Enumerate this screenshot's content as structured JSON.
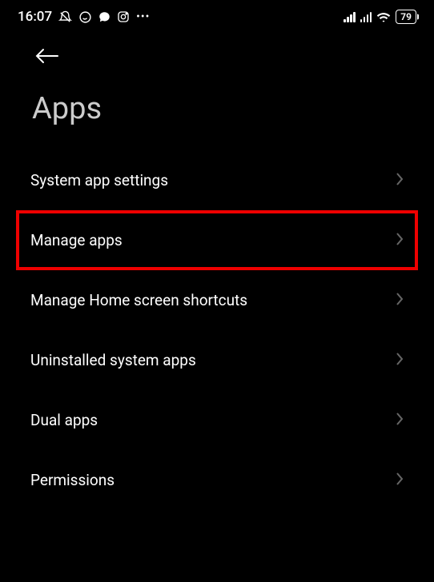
{
  "status_bar": {
    "time": "16:07",
    "battery": "79"
  },
  "page": {
    "title": "Apps"
  },
  "menu": {
    "items": [
      {
        "label": "System app settings",
        "highlighted": false
      },
      {
        "label": "Manage apps",
        "highlighted": true
      },
      {
        "label": "Manage Home screen shortcuts",
        "highlighted": false
      },
      {
        "label": "Uninstalled system apps",
        "highlighted": false
      },
      {
        "label": "Dual apps",
        "highlighted": false
      },
      {
        "label": "Permissions",
        "highlighted": false
      }
    ]
  }
}
